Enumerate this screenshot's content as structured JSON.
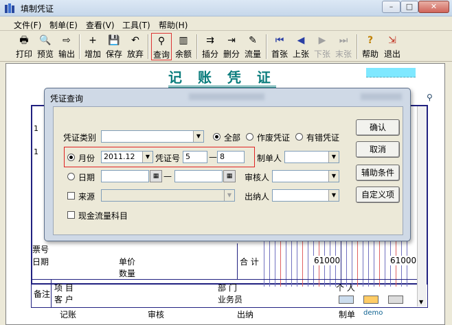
{
  "window": {
    "title": "填制凭证",
    "min": "–",
    "max": "□",
    "close": "✕"
  },
  "menu": [
    "文件(F)",
    "制单(E)",
    "查看(V)",
    "工具(T)",
    "帮助(H)"
  ],
  "toolbar": [
    {
      "label": "打印",
      "icon": "🖶"
    },
    {
      "label": "预览",
      "icon": "🔍"
    },
    {
      "label": "输出",
      "icon": "⇨"
    },
    {
      "label": "增加",
      "icon": "+"
    },
    {
      "label": "保存",
      "icon": "💾"
    },
    {
      "label": "放弃",
      "icon": "↶"
    },
    {
      "label": "查询",
      "icon": "⚲"
    },
    {
      "label": "余额",
      "icon": "▥"
    },
    {
      "label": "插分",
      "icon": "⇉"
    },
    {
      "label": "删分",
      "icon": "⇥"
    },
    {
      "label": "流量",
      "icon": "✎"
    },
    {
      "label": "首张",
      "icon": "⏮"
    },
    {
      "label": "上张",
      "icon": "◀"
    },
    {
      "label": "下张",
      "icon": "▶"
    },
    {
      "label": "末张",
      "icon": "⏭"
    },
    {
      "label": "帮助",
      "icon": "?"
    },
    {
      "label": "退出",
      "icon": "⇲"
    }
  ],
  "voucher": {
    "title": "记 账 凭 证",
    "rows": [
      "1",
      "1"
    ],
    "amount_left": "61000",
    "amount_right": "61000",
    "ticket_no": "票号",
    "date": "日期",
    "unit_price": "单价",
    "quantity": "数量",
    "total": "合 计",
    "remark": "备注",
    "project": "项  目",
    "customer": "客  户",
    "department": "部  门",
    "salesperson": "业务员",
    "person": "个  人",
    "footer": {
      "bookkeep": "记账",
      "audit": "审核",
      "cashier": "出纳",
      "maker_label": "制单",
      "maker": "demo"
    }
  },
  "dialog": {
    "title": "凭证查询",
    "voucher_type_label": "凭证类别",
    "voucher_type_value": "",
    "radio_all": "全部",
    "radio_void": "作废凭证",
    "radio_error": "有错凭证",
    "month_label": "月份",
    "month_value": "2011.12",
    "voucher_no_label": "凭证号",
    "voucher_no_from": "5",
    "voucher_no_dash": "—",
    "voucher_no_to": "8",
    "maker_label": "制单人",
    "date_label": "日期",
    "date_dash": "—",
    "auditor_label": "审核人",
    "source_label": "来源",
    "cashier_label": "出纳人",
    "cashflow_label": "现金流量科目",
    "buttons": {
      "ok": "确认",
      "cancel": "取消",
      "aux": "辅助条件",
      "custom": "自定义项"
    }
  }
}
